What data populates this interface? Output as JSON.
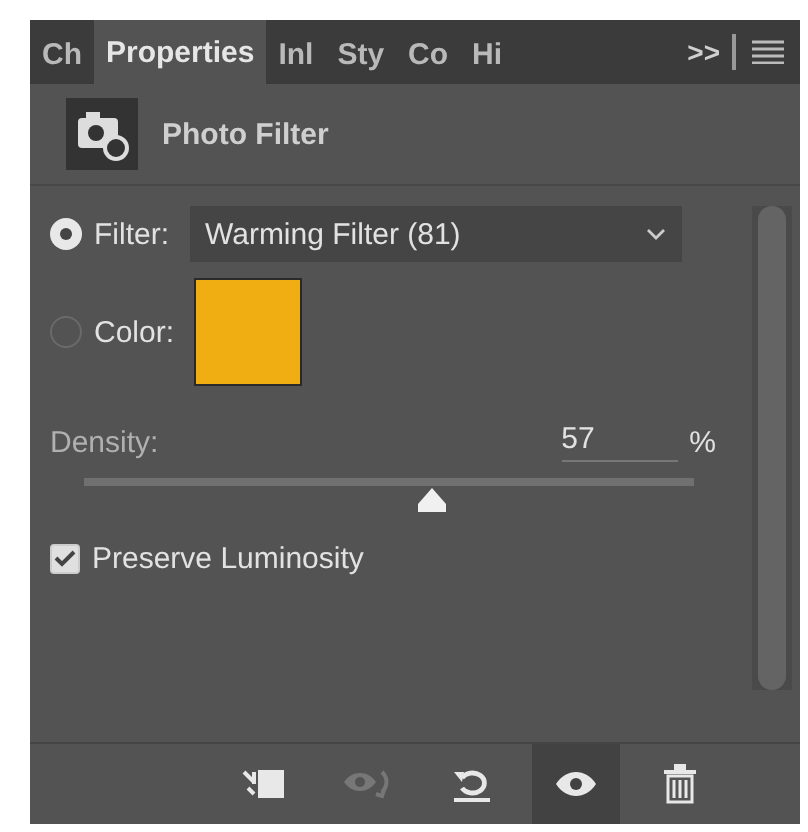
{
  "tabs": [
    {
      "label": "Ch",
      "selected": false
    },
    {
      "label": "Properties",
      "selected": true
    },
    {
      "label": "Inl",
      "selected": false
    },
    {
      "label": "Sty",
      "selected": false
    },
    {
      "label": "Co",
      "selected": false
    },
    {
      "label": "Hi",
      "selected": false
    }
  ],
  "overflow": ">>",
  "header": {
    "title": "Photo Filter"
  },
  "filter": {
    "label": "Filter:",
    "selected": true,
    "value": "Warming Filter (81)"
  },
  "color": {
    "label": "Color:",
    "selected": false,
    "color": "#f0ae12"
  },
  "density": {
    "label": "Density:",
    "value": "57",
    "unit": "%",
    "level": 0.57
  },
  "preserve": {
    "label": "Preserve Luminosity",
    "checked": true
  },
  "footer": [
    {
      "kind": "clip",
      "disabled": false,
      "selected": false
    },
    {
      "kind": "view-previous",
      "disabled": true,
      "selected": false
    },
    {
      "kind": "reset",
      "disabled": false,
      "selected": false
    },
    {
      "kind": "visibility",
      "disabled": false,
      "selected": true
    },
    {
      "kind": "delete",
      "disabled": false,
      "selected": false
    }
  ]
}
